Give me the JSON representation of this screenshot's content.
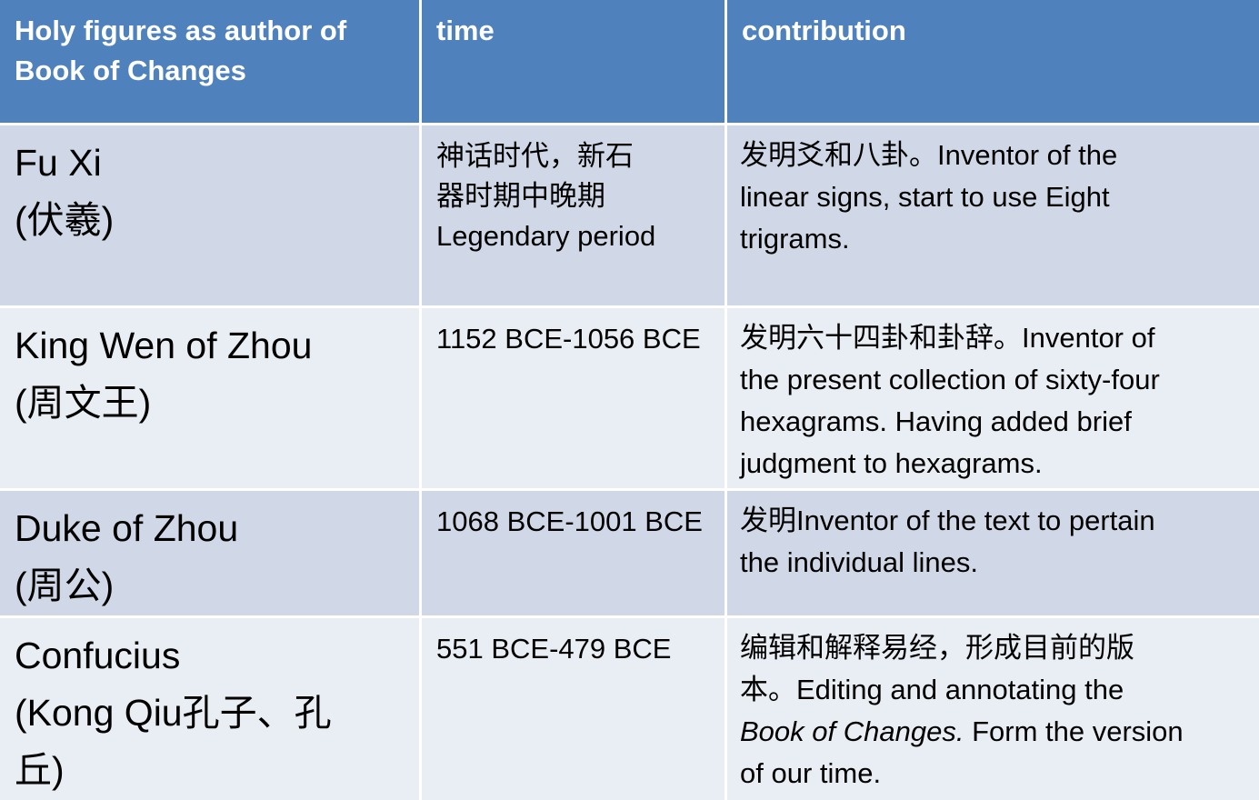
{
  "header": {
    "col1": [
      "Holy figures as author of",
      "Book of Changes"
    ],
    "col2": "time",
    "col3": "contribution"
  },
  "rows": [
    {
      "name": [
        "Fu Xi",
        "(伏羲)"
      ],
      "time": [
        "神话时代，新石",
        "器时期中晚期",
        "Legendary period"
      ],
      "contribution": [
        "发明爻和八卦。Inventor of the",
        "linear signs, start to use Eight",
        "trigrams."
      ]
    },
    {
      "name": [
        "King Wen of Zhou",
        "(周文王)"
      ],
      "time": [
        "1152 BCE-1056 BCE"
      ],
      "contribution": [
        "发明六十四卦和卦辞。Inventor of",
        "the present collection of sixty-four",
        "hexagrams. Having added brief",
        "judgment to hexagrams."
      ]
    },
    {
      "name": [
        "Duke of Zhou",
        "(周公)"
      ],
      "time": [
        "1068 BCE-1001 BCE"
      ],
      "contribution": [
        "发明Inventor of the text to pertain",
        "the individual lines."
      ]
    },
    {
      "name": [
        "Confucius",
        "(Kong Qiu孔子、孔",
        "丘)"
      ],
      "time": [
        "551 BCE-479 BCE"
      ],
      "contribution": {
        "line1": "编辑和解释易经，形成目前的版",
        "line2": "本。Editing and annotating the",
        "line3_italic": "Book of Changes.",
        "line3_rest": " Form the version",
        "line4": "of our time."
      }
    }
  ]
}
